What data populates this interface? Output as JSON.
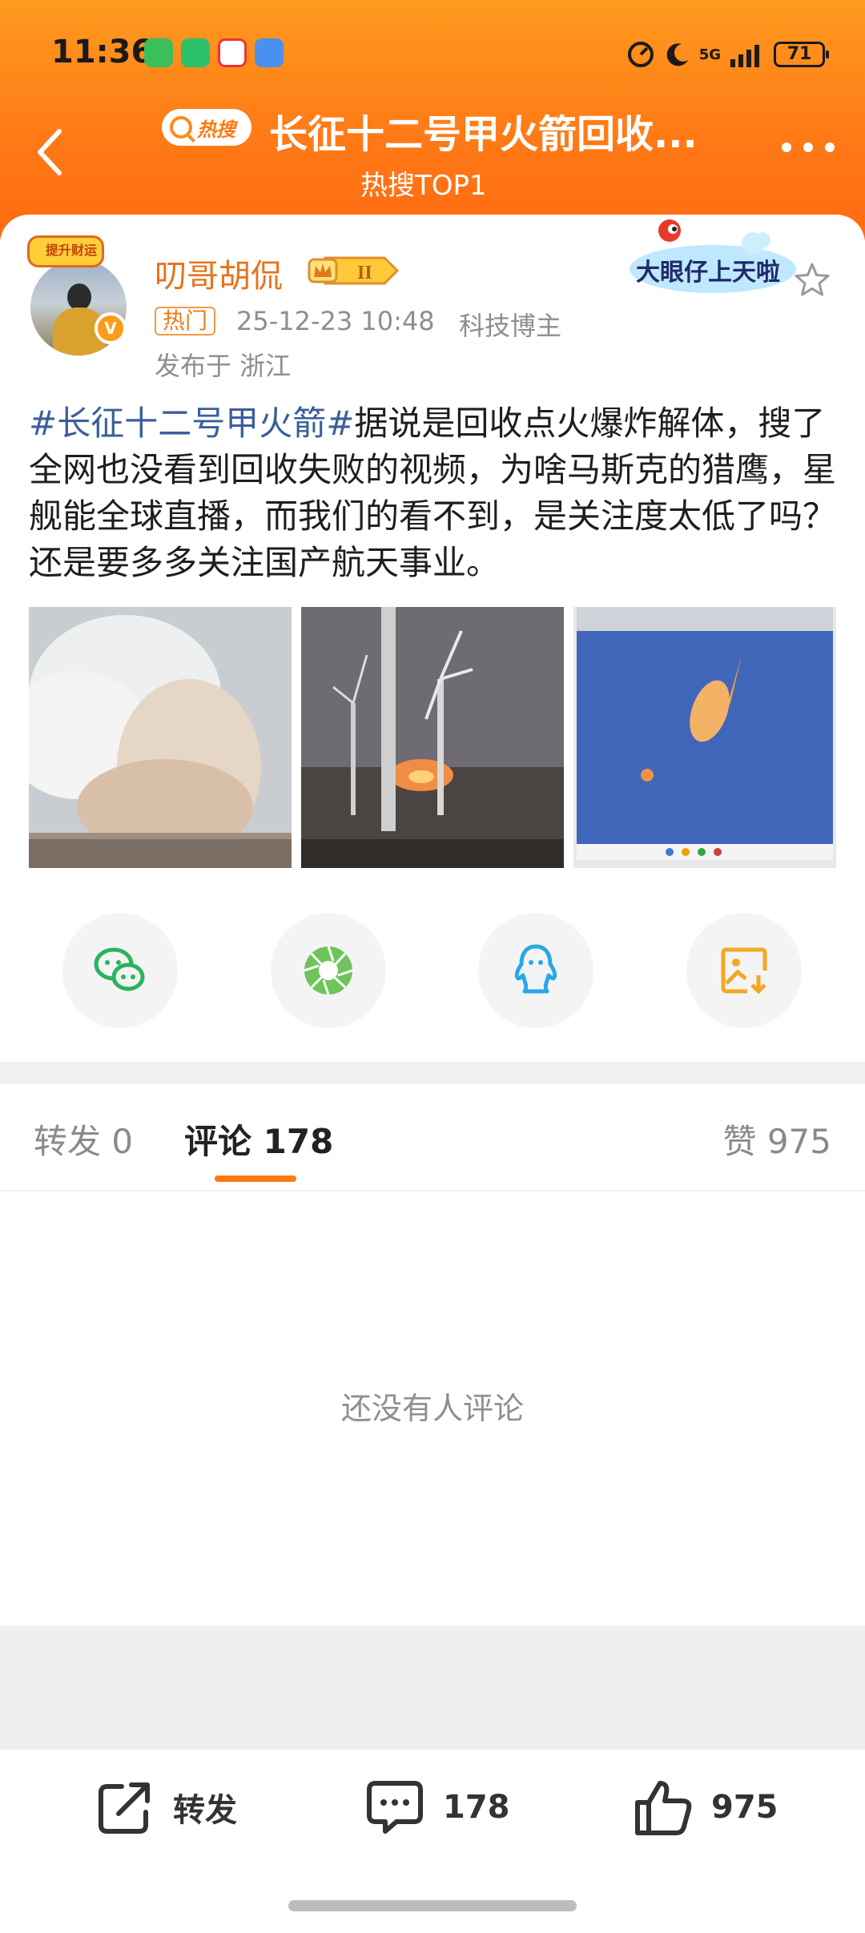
{
  "status_bar": {
    "time": "11:36",
    "network": "5G",
    "battery": "71"
  },
  "header": {
    "hot_badge": "热搜",
    "topic_title": "长征十二号甲火箭回收...",
    "topic_subtitle": "热搜TOP1"
  },
  "post": {
    "avatar_frame_text": "提升财运",
    "username": "叨哥胡侃",
    "level_badge": "II",
    "tag": "热门",
    "time": "25-12-23 10:48",
    "role": "科技博主",
    "location": "发布于 浙江",
    "sticker_text": "大眼仔上天啦",
    "hashtag": "#长征十二号甲火箭#",
    "text": "据说是回收点火爆炸解体，搜了全网也没看到回收失败的视频，为啥马斯克的猎鹰，星舰能全球直播，而我们的看不到，是关注度太低了吗？还是要多多关注国产航天事业。"
  },
  "share_icons": [
    "wechat-icon",
    "moments-icon",
    "qq-icon",
    "save-image-icon"
  ],
  "tabs": {
    "repost": "转发 0",
    "comments": "评论 178",
    "likes": "赞 975"
  },
  "empty_state": "还没有人评论",
  "bottom_bar": {
    "repost_label": "转发",
    "comment_count": "178",
    "like_count": "975"
  },
  "colors": {
    "accent": "#ff7a13",
    "hashtag": "#3a5f9c",
    "username": "#e8731b"
  }
}
